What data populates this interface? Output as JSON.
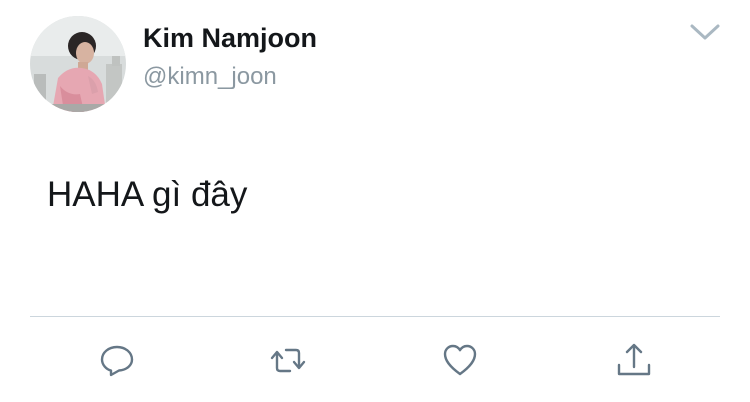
{
  "tweet": {
    "author": {
      "display_name": "Kim Namjoon",
      "handle": "@kimn_joon",
      "avatar_icon": "profile-photo"
    },
    "text": "HAHA gì đây"
  },
  "actions": [
    {
      "name": "reply",
      "icon": "reply-icon"
    },
    {
      "name": "retweet",
      "icon": "retweet-icon"
    },
    {
      "name": "like",
      "icon": "heart-icon"
    },
    {
      "name": "share",
      "icon": "share-icon"
    }
  ],
  "menu": {
    "icon": "chevron-down-icon"
  },
  "colors": {
    "text": "#14171a",
    "secondary": "#8b98a1",
    "icon": "#657786",
    "divider": "#ccd6dd"
  }
}
